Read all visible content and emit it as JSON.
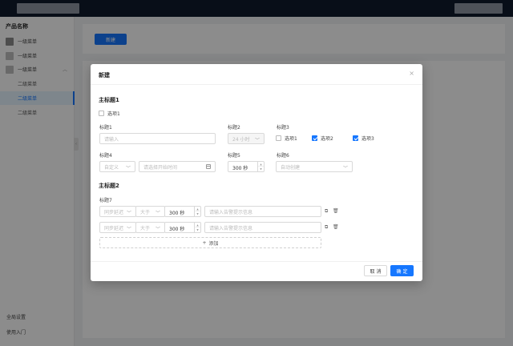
{
  "sidebar": {
    "product_name": "产品名称",
    "items": [
      {
        "label": "一级菜单"
      },
      {
        "label": "一级菜单"
      },
      {
        "label": "一级菜单"
      }
    ],
    "sub_items": [
      {
        "label": "二级菜单"
      },
      {
        "label": "二级菜单"
      },
      {
        "label": "二级菜单"
      }
    ],
    "footer": {
      "settings": "全局设置",
      "guide": "使用入门"
    }
  },
  "main": {
    "new_button": "新建"
  },
  "modal": {
    "title": "新建",
    "close": "×",
    "section1": {
      "title": "主标题1",
      "option1": "选项1",
      "label1": "标题1",
      "input1_placeholder": "请输入",
      "label2": "标题2",
      "select2_value": "24 小时",
      "label3": "标题3",
      "checkboxes": [
        {
          "label": "选项1",
          "checked": false
        },
        {
          "label": "选项2",
          "checked": true
        },
        {
          "label": "选项3",
          "checked": true
        }
      ],
      "label4": "标题4",
      "select4_value": "自定义",
      "date_placeholder": "请选择开始时间",
      "label5": "标题5",
      "stepper5_value": "300 秒",
      "label6": "标题6",
      "select6_value": "自动创建"
    },
    "section2": {
      "title": "主标题2",
      "label7": "标题7",
      "rows": [
        {
          "sync": "同步延迟",
          "op": "大于",
          "value": "300 秒",
          "placeholder": "请输入告警提示信息"
        },
        {
          "sync": "同步延迟",
          "op": "大于",
          "value": "300 秒",
          "placeholder": "请输入告警提示信息"
        }
      ],
      "add_label": "添加",
      "add_icon": "+"
    },
    "footer": {
      "cancel": "取 消",
      "ok": "确 定"
    }
  },
  "colors": {
    "primary": "#1677ff",
    "topbar": "#0f1b2d"
  }
}
